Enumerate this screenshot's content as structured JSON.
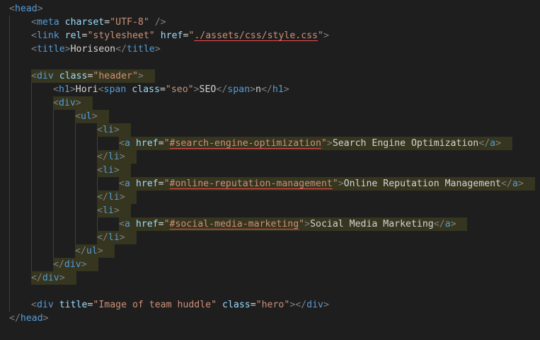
{
  "lines": [
    [
      {
        "k": "br",
        "t": "<"
      },
      {
        "k": "tag",
        "t": "head"
      },
      {
        "k": "br",
        "t": ">"
      }
    ],
    [
      {
        "k": "br",
        "t": "<"
      },
      {
        "k": "tag",
        "t": "meta"
      },
      {
        "k": "txt",
        "t": " "
      },
      {
        "k": "attr",
        "t": "charset"
      },
      {
        "k": "txt",
        "t": "="
      },
      {
        "k": "str",
        "t": "\"UTF-8\""
      },
      {
        "k": "txt",
        "t": " "
      },
      {
        "k": "br",
        "t": "/>"
      }
    ],
    [
      {
        "k": "br",
        "t": "<"
      },
      {
        "k": "tag",
        "t": "link"
      },
      {
        "k": "txt",
        "t": " "
      },
      {
        "k": "attr",
        "t": "rel"
      },
      {
        "k": "txt",
        "t": "="
      },
      {
        "k": "str",
        "t": "\"stylesheet\""
      },
      {
        "k": "txt",
        "t": " "
      },
      {
        "k": "attr",
        "t": "href"
      },
      {
        "k": "txt",
        "t": "="
      },
      {
        "k": "str",
        "t": "\""
      },
      {
        "k": "str ul",
        "t": "./assets/css/style.css"
      },
      {
        "k": "str",
        "t": "\""
      },
      {
        "k": "br",
        "t": ">"
      }
    ],
    [
      {
        "k": "br",
        "t": "<"
      },
      {
        "k": "tag",
        "t": "title"
      },
      {
        "k": "br",
        "t": ">"
      },
      {
        "k": "txt",
        "t": "Horiseon"
      },
      {
        "k": "br",
        "t": "</"
      },
      {
        "k": "tag",
        "t": "title"
      },
      {
        "k": "br",
        "t": ">"
      }
    ],
    [],
    [
      {
        "k": "br",
        "t": "<"
      },
      {
        "k": "tag",
        "t": "div"
      },
      {
        "k": "txt",
        "t": " "
      },
      {
        "k": "attr",
        "t": "class"
      },
      {
        "k": "txt",
        "t": "="
      },
      {
        "k": "str",
        "t": "\"header\""
      },
      {
        "k": "br",
        "t": ">"
      }
    ],
    [
      {
        "k": "br",
        "t": "<"
      },
      {
        "k": "tag",
        "t": "h1"
      },
      {
        "k": "br",
        "t": ">"
      },
      {
        "k": "txt",
        "t": "Hori"
      },
      {
        "k": "br",
        "t": "<"
      },
      {
        "k": "tag",
        "t": "span"
      },
      {
        "k": "txt",
        "t": " "
      },
      {
        "k": "attr",
        "t": "class"
      },
      {
        "k": "txt",
        "t": "="
      },
      {
        "k": "str",
        "t": "\"seo\""
      },
      {
        "k": "br",
        "t": ">"
      },
      {
        "k": "txt",
        "t": "SEO"
      },
      {
        "k": "br",
        "t": "</"
      },
      {
        "k": "tag",
        "t": "span"
      },
      {
        "k": "br",
        "t": ">"
      },
      {
        "k": "txt",
        "t": "n"
      },
      {
        "k": "br",
        "t": "</"
      },
      {
        "k": "tag",
        "t": "h1"
      },
      {
        "k": "br",
        "t": ">"
      }
    ],
    [
      {
        "k": "br",
        "t": "<"
      },
      {
        "k": "tag",
        "t": "div"
      },
      {
        "k": "br",
        "t": ">"
      }
    ],
    [
      {
        "k": "br",
        "t": "<"
      },
      {
        "k": "tag",
        "t": "ul"
      },
      {
        "k": "br",
        "t": ">"
      }
    ],
    [
      {
        "k": "br",
        "t": "<"
      },
      {
        "k": "tag",
        "t": "li"
      },
      {
        "k": "br",
        "t": ">"
      }
    ],
    [
      {
        "k": "br",
        "t": "<"
      },
      {
        "k": "tag",
        "t": "a"
      },
      {
        "k": "txt",
        "t": " "
      },
      {
        "k": "attr",
        "t": "href"
      },
      {
        "k": "txt",
        "t": "="
      },
      {
        "k": "str",
        "t": "\""
      },
      {
        "k": "str ul",
        "t": "#search-engine-optimization"
      },
      {
        "k": "str",
        "t": "\""
      },
      {
        "k": "br",
        "t": ">"
      },
      {
        "k": "txt",
        "t": "Search Engine Optimization"
      },
      {
        "k": "br",
        "t": "</"
      },
      {
        "k": "tag",
        "t": "a"
      },
      {
        "k": "br",
        "t": ">"
      }
    ],
    [
      {
        "k": "br",
        "t": "</"
      },
      {
        "k": "tag",
        "t": "li"
      },
      {
        "k": "br",
        "t": ">"
      }
    ],
    [
      {
        "k": "br",
        "t": "<"
      },
      {
        "k": "tag",
        "t": "li"
      },
      {
        "k": "br",
        "t": ">"
      }
    ],
    [
      {
        "k": "br",
        "t": "<"
      },
      {
        "k": "tag",
        "t": "a"
      },
      {
        "k": "txt",
        "t": " "
      },
      {
        "k": "attr",
        "t": "href"
      },
      {
        "k": "txt",
        "t": "="
      },
      {
        "k": "str",
        "t": "\""
      },
      {
        "k": "str ul",
        "t": "#online-reputation-management"
      },
      {
        "k": "str",
        "t": "\""
      },
      {
        "k": "br",
        "t": ">"
      },
      {
        "k": "txt",
        "t": "Online Reputation Management"
      },
      {
        "k": "br",
        "t": "</"
      },
      {
        "k": "tag",
        "t": "a"
      },
      {
        "k": "br",
        "t": ">"
      }
    ],
    [
      {
        "k": "br",
        "t": "</"
      },
      {
        "k": "tag",
        "t": "li"
      },
      {
        "k": "br",
        "t": ">"
      }
    ],
    [
      {
        "k": "br",
        "t": "<"
      },
      {
        "k": "tag",
        "t": "li"
      },
      {
        "k": "br",
        "t": ">"
      }
    ],
    [
      {
        "k": "br",
        "t": "<"
      },
      {
        "k": "tag",
        "t": "a"
      },
      {
        "k": "txt",
        "t": " "
      },
      {
        "k": "attr",
        "t": "href"
      },
      {
        "k": "txt",
        "t": "="
      },
      {
        "k": "str",
        "t": "\""
      },
      {
        "k": "str ul",
        "t": "#social-media-marketing"
      },
      {
        "k": "str",
        "t": "\""
      },
      {
        "k": "br",
        "t": ">"
      },
      {
        "k": "txt",
        "t": "Social Media Marketing"
      },
      {
        "k": "br",
        "t": "</"
      },
      {
        "k": "tag",
        "t": "a"
      },
      {
        "k": "br",
        "t": ">"
      }
    ],
    [
      {
        "k": "br",
        "t": "</"
      },
      {
        "k": "tag",
        "t": "li"
      },
      {
        "k": "br",
        "t": ">"
      }
    ],
    [
      {
        "k": "br",
        "t": "</"
      },
      {
        "k": "tag",
        "t": "ul"
      },
      {
        "k": "br",
        "t": ">"
      }
    ],
    [
      {
        "k": "br",
        "t": "</"
      },
      {
        "k": "tag",
        "t": "div"
      },
      {
        "k": "br",
        "t": ">"
      }
    ],
    [
      {
        "k": "br",
        "t": "</"
      },
      {
        "k": "tag",
        "t": "div"
      },
      {
        "k": "br",
        "t": ">"
      }
    ],
    [],
    [
      {
        "k": "br",
        "t": "<"
      },
      {
        "k": "tag",
        "t": "div"
      },
      {
        "k": "txt",
        "t": " "
      },
      {
        "k": "attr",
        "t": "title"
      },
      {
        "k": "txt",
        "t": "="
      },
      {
        "k": "str",
        "t": "\"Image of team huddle\""
      },
      {
        "k": "txt",
        "t": " "
      },
      {
        "k": "attr",
        "t": "class"
      },
      {
        "k": "txt",
        "t": "="
      },
      {
        "k": "str",
        "t": "\"hero\""
      },
      {
        "k": "br",
        "t": ">"
      },
      {
        "k": "br",
        "t": "</"
      },
      {
        "k": "tag",
        "t": "div"
      },
      {
        "k": "br",
        "t": ">"
      }
    ],
    [
      {
        "k": "br",
        "t": "</"
      },
      {
        "k": "tag",
        "t": "head"
      },
      {
        "k": "br",
        "t": ">"
      }
    ]
  ]
}
